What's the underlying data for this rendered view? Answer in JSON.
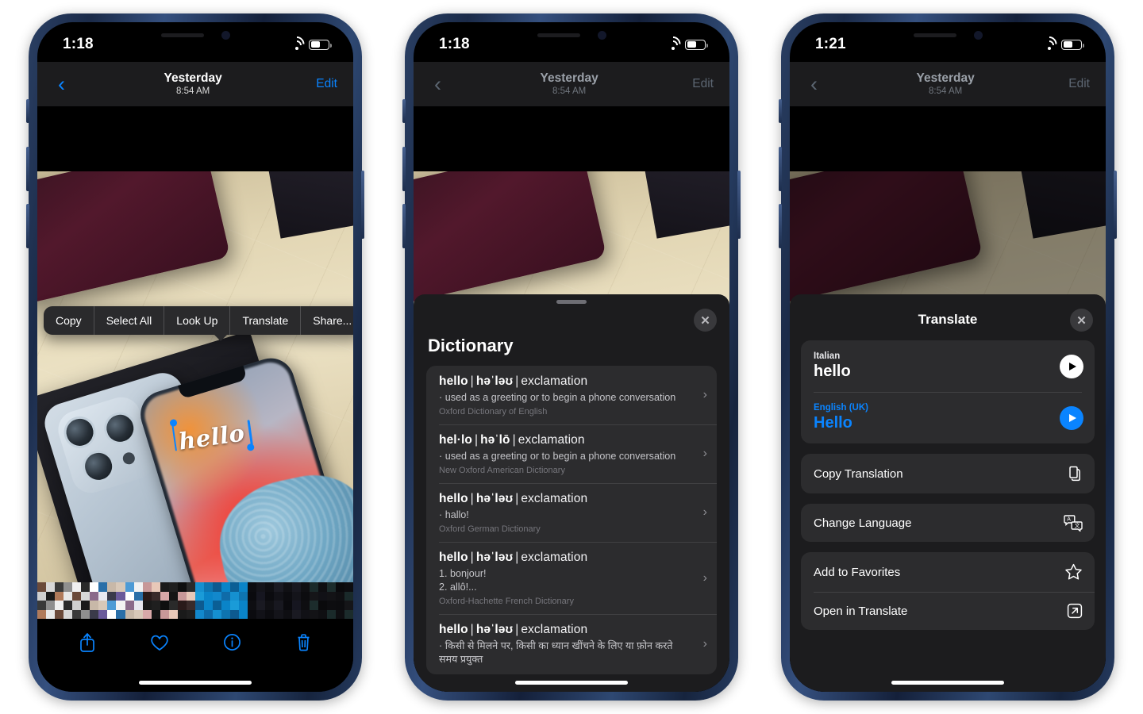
{
  "phones": [
    {
      "status": {
        "time": "1:18",
        "wifi_icon": "wifi-icon",
        "battery_icon": "battery-icon"
      },
      "nav": {
        "back_icon": "chevron-left-icon",
        "title": "Yesterday",
        "subtitle": "8:54 AM",
        "edit_label": "Edit",
        "dimmed": false
      },
      "selected_text": "hello",
      "context_menu": [
        "Copy",
        "Select All",
        "Look Up",
        "Translate",
        "Share..."
      ],
      "toolbar": [
        {
          "name": "share-icon",
          "label": "Share"
        },
        {
          "name": "heart-icon",
          "label": "Favorite"
        },
        {
          "name": "info-icon",
          "label": "Info"
        },
        {
          "name": "trash-icon",
          "label": "Delete"
        }
      ]
    },
    {
      "status": {
        "time": "1:18"
      },
      "nav": {
        "title": "Yesterday",
        "subtitle": "8:54 AM",
        "edit_label": "Edit",
        "dimmed": true
      },
      "sheet": {
        "title": "Dictionary",
        "close_icon": "close-icon",
        "entries": [
          {
            "word": "hello",
            "ipa": "həˈləʊ",
            "pos": "exclamation",
            "definition": "· used as a greeting or to begin a phone conversation",
            "source": "Oxford Dictionary of English"
          },
          {
            "word": "hel·lo",
            "ipa": "həˈlō",
            "pos": "exclamation",
            "definition": "· used as a greeting or to begin a phone conversation",
            "source": "New Oxford American Dictionary"
          },
          {
            "word": "hello",
            "ipa": "həˈləʊ",
            "pos": "exclamation",
            "definition": "· hallo!",
            "source": "Oxford German Dictionary"
          },
          {
            "word": "hello",
            "ipa": "həˈləʊ",
            "pos": "exclamation",
            "definition": "1. bonjour!\n2. allô!...",
            "source": "Oxford-Hachette French Dictionary"
          },
          {
            "word": "hello",
            "ipa": "həˈləʊ",
            "pos": "exclamation",
            "definition": "· किसी से मिलने पर, किसी का ध्यान खींचने के लिए या फ़ोन करते समय प्रयुक्त",
            "source": ""
          }
        ]
      }
    },
    {
      "status": {
        "time": "1:21"
      },
      "nav": {
        "title": "Yesterday",
        "subtitle": "8:54 AM",
        "edit_label": "Edit",
        "dimmed": true
      },
      "sheet": {
        "title": "Translate",
        "close_icon": "close-icon",
        "source": {
          "language": "Italian",
          "text": "hello",
          "play_icon": "play-icon"
        },
        "target": {
          "language": "English (UK)",
          "text": "Hello",
          "play_icon": "play-icon"
        },
        "actions": [
          {
            "label": "Copy Translation",
            "icon": "copy-icon"
          },
          {
            "label": "Change Language",
            "icon": "change-language-icon"
          },
          {
            "label": "Add to Favorites",
            "icon": "star-icon"
          },
          {
            "label": "Open in Translate",
            "icon": "open-external-icon"
          }
        ]
      }
    }
  ],
  "colors": {
    "accent_blue": "#0a84ff",
    "sheet_bg": "#1c1c1e",
    "card_bg": "#2c2c2e",
    "menu_bg": "#2a2a2c",
    "frame_blue": "#27406a"
  }
}
